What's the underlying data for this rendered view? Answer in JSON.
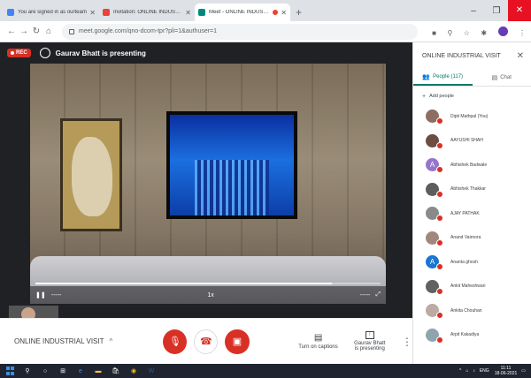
{
  "browser": {
    "tabs": [
      {
        "title": "You are signed in as ourteam",
        "fav": "#4285f4",
        "icon": "sites-icon"
      },
      {
        "title": "Invitation: ONLINE INDUSTRIAL V",
        "fav": "#ea4335",
        "icon": "gmail-icon"
      },
      {
        "title": "Meet - ONLINE INDUSTRIAL",
        "fav": "#00897b",
        "icon": "meet-icon"
      }
    ],
    "new_tab": "+",
    "url": "meet.google.com/qno-dcom-tpr?pli=1&authuser=1"
  },
  "presenter": {
    "rec_label": "REC",
    "text": "Gaurav Bhatt is presenting"
  },
  "video": {
    "time_left": "-----",
    "time_right": "-----",
    "progress": 0.86,
    "center_label": "1x"
  },
  "callbar": {
    "meeting_name": "ONLINE INDUSTRIAL VISIT",
    "captions_label": "Turn on captions",
    "present_line1": "Gaurav Bhatt",
    "present_line2": "is presenting"
  },
  "panel": {
    "title": "ONLINE INDUSTRIAL VISIT",
    "tab_people": "People (117)",
    "tab_chat": "Chat",
    "add_people": "Add people",
    "people": [
      {
        "name": "Dipti Mathpal (You)",
        "color": "#8d6e63",
        "initial": ""
      },
      {
        "name": "AAYUSHI SHAH",
        "color": "#6d4c41",
        "initial": ""
      },
      {
        "name": "Abhishek Badwale",
        "color": "#9575cd",
        "initial": "A"
      },
      {
        "name": "Abhishek Thakkar",
        "color": "#5d5d5d",
        "initial": ""
      },
      {
        "name": "AJAY PATHAK",
        "color": "#8a8a8a",
        "initial": ""
      },
      {
        "name": "Anand Vairnora",
        "color": "#a1887f",
        "initial": ""
      },
      {
        "name": "Ananta ghosh",
        "color": "#1976d2",
        "initial": "A"
      },
      {
        "name": "Ankit Maheshwari",
        "color": "#616161",
        "initial": ""
      },
      {
        "name": "Ankita Chouhan",
        "color": "#bcaaa4",
        "initial": ""
      },
      {
        "name": "Arpit Kakadiya",
        "color": "#90a4ae",
        "initial": ""
      }
    ]
  },
  "taskbar": {
    "lang": "ENG",
    "time": "11:11",
    "date": "18-06-2021"
  }
}
